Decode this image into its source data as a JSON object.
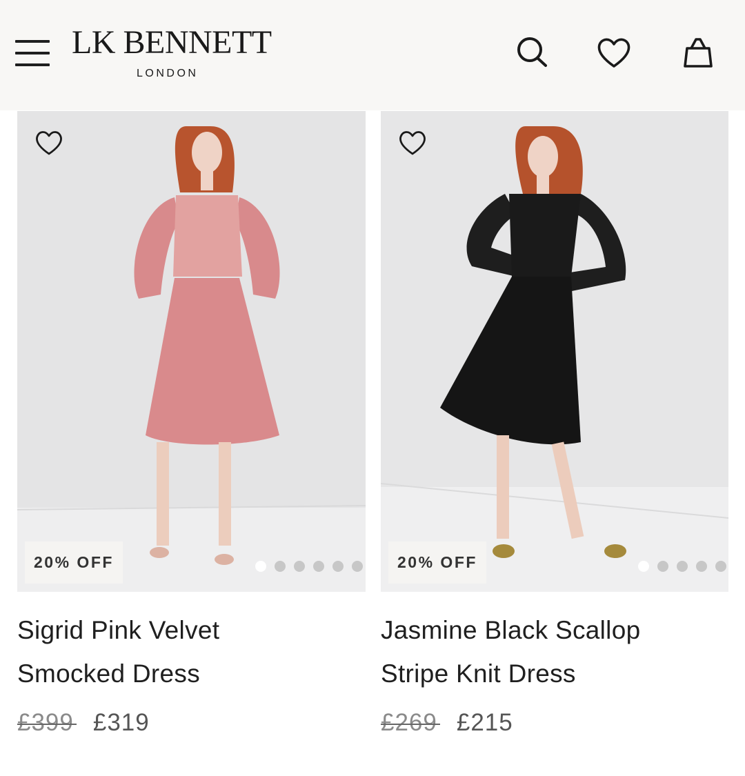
{
  "header": {
    "brand_name": "LK BENNETT",
    "brand_sub": "LONDON",
    "icons": [
      "menu-icon",
      "search-icon",
      "heart-icon",
      "bag-icon"
    ]
  },
  "products": [
    {
      "title_line1": "Sigrid Pink Velvet",
      "title_line2": "Smocked Dress",
      "badge": "20% OFF",
      "old_price": "£399",
      "new_price": "£319",
      "image_dots": 6,
      "active_dot": 1,
      "dress_color": "#d98a8c"
    },
    {
      "title_line1": "Jasmine Black Scallop",
      "title_line2": "Stripe Knit Dress",
      "badge": "20% OFF",
      "old_price": "£269",
      "new_price": "£215",
      "image_dots": 5,
      "active_dot": 1,
      "dress_color": "#161616"
    }
  ],
  "colors": {
    "header_bg": "#f8f7f5",
    "photo_bg": "#e3e3e4",
    "text": "#1f1f1f",
    "price_muted": "#8a8a8a"
  }
}
